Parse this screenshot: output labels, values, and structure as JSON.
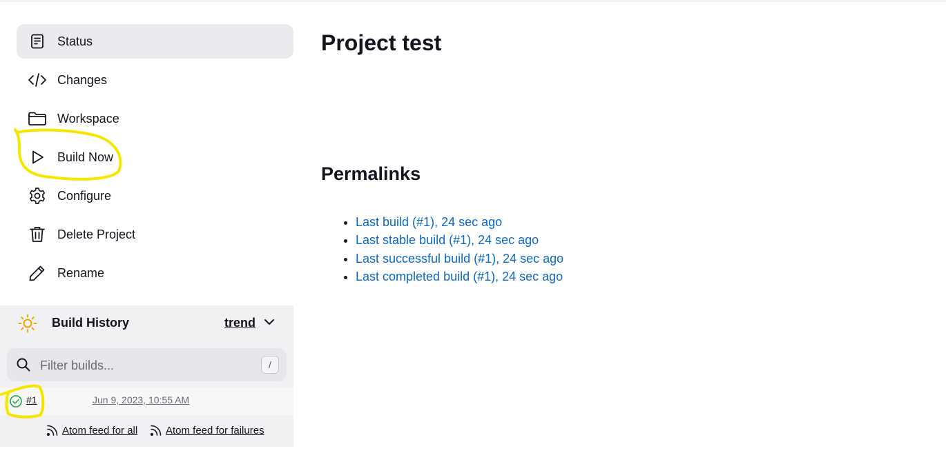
{
  "sidebar": {
    "items": [
      {
        "label": "Status",
        "icon": "status-icon"
      },
      {
        "label": "Changes",
        "icon": "code-icon"
      },
      {
        "label": "Workspace",
        "icon": "folder-icon"
      },
      {
        "label": "Build Now",
        "icon": "play-icon"
      },
      {
        "label": "Configure",
        "icon": "gear-icon"
      },
      {
        "label": "Delete Project",
        "icon": "trash-icon"
      },
      {
        "label": "Rename",
        "icon": "pencil-icon"
      }
    ]
  },
  "build_history": {
    "title": "Build History",
    "trend_label": "trend",
    "filter": {
      "placeholder": "Filter builds...",
      "shortcut": "/"
    },
    "builds": [
      {
        "number": "#1",
        "date": "Jun 9, 2023, 10:55 AM",
        "status": "success"
      }
    ],
    "feeds": {
      "all": "Atom feed for all",
      "failures": "Atom feed for failures"
    }
  },
  "main": {
    "title": "Project test",
    "permalinks_title": "Permalinks",
    "permalinks": [
      "Last build (#1), 24 sec ago",
      "Last stable build (#1), 24 sec ago",
      "Last successful build (#1), 24 sec ago",
      "Last completed build (#1), 24 sec ago"
    ]
  },
  "colors": {
    "link": "#0b69c7",
    "highlight_annotation": "#f5e600",
    "success": "#1ea64b",
    "active_nav_bg": "#ebebef"
  }
}
